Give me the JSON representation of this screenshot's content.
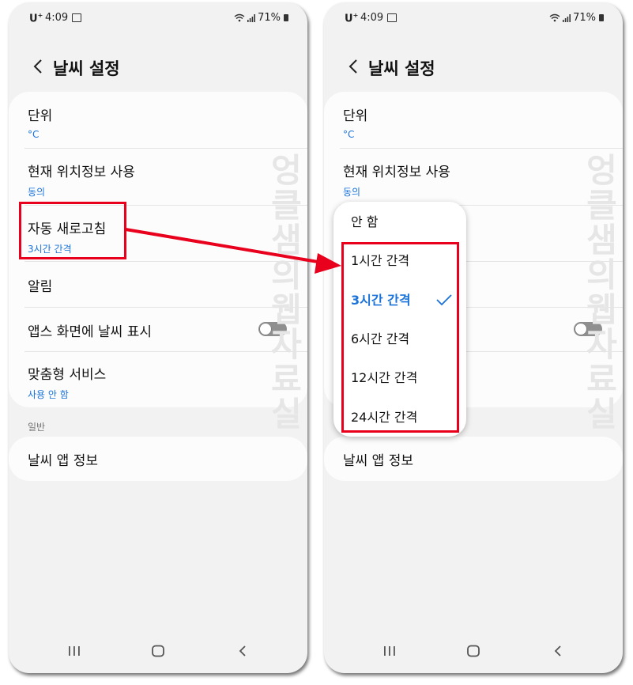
{
  "status_bar": {
    "carrier": "U",
    "carrier_sup": "+",
    "time": "4:09",
    "battery": "71%"
  },
  "header": {
    "title": "날씨 설정"
  },
  "settings": {
    "unit": {
      "title": "단위",
      "value": "°C"
    },
    "location": {
      "title": "현재 위치정보 사용",
      "value": "동의"
    },
    "auto_refresh": {
      "title": "자동 새로고침",
      "value": "3시간 간격"
    },
    "alerts": {
      "title": "알림"
    },
    "apps_screen": {
      "title": "앱스 화면에 날씨 표시",
      "toggle_on": false
    },
    "custom_service": {
      "title": "맞춤형 서비스",
      "value": "사용 안 함"
    },
    "section_general": "일반",
    "app_info": {
      "title": "날씨 앱 정보"
    }
  },
  "dropdown": {
    "options": [
      {
        "label": "안 함",
        "selected": false
      },
      {
        "label": "1시간 간격",
        "selected": false
      },
      {
        "label": "3시간 간격",
        "selected": true
      },
      {
        "label": "6시간 간격",
        "selected": false
      },
      {
        "label": "12시간 간격",
        "selected": false
      },
      {
        "label": "24시간 간격",
        "selected": false
      }
    ]
  },
  "watermark": "엉클샘의웹자료실",
  "colors": {
    "accent": "#1a73d9",
    "highlight": "#e8001c",
    "background": "#f2f2f2",
    "card": "#fcfcfc"
  },
  "icons": [
    "back-arrow-icon",
    "wifi-icon",
    "signal-icon",
    "battery-icon",
    "image-icon",
    "check-icon",
    "recent-apps-icon",
    "home-icon",
    "nav-back-icon",
    "arrow-annotation"
  ]
}
